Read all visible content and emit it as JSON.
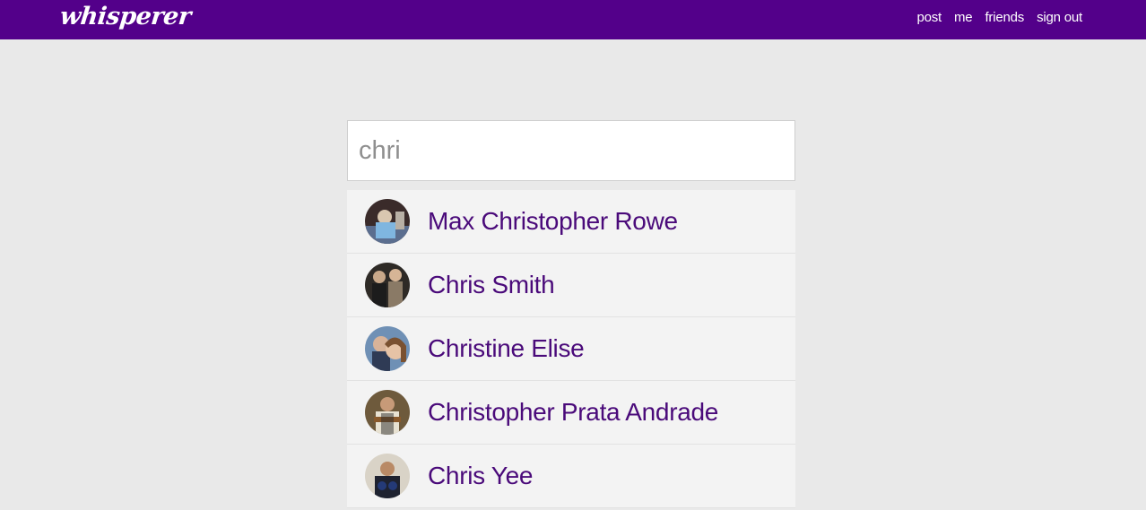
{
  "brand": {
    "logo_text": "whisperer"
  },
  "nav": {
    "links": [
      {
        "label": "post"
      },
      {
        "label": "me"
      },
      {
        "label": "friends"
      },
      {
        "label": "sign out"
      }
    ]
  },
  "search": {
    "value": "chri"
  },
  "results": [
    {
      "name": "Max Christopher Rowe"
    },
    {
      "name": "Chris Smith"
    },
    {
      "name": "Christine Elise"
    },
    {
      "name": "Christopher Prata Andrade"
    },
    {
      "name": "Chris Yee"
    }
  ],
  "colors": {
    "navbar": "#53008a",
    "page_background": "#e9e9e9",
    "result_name": "#4a0a7a"
  }
}
